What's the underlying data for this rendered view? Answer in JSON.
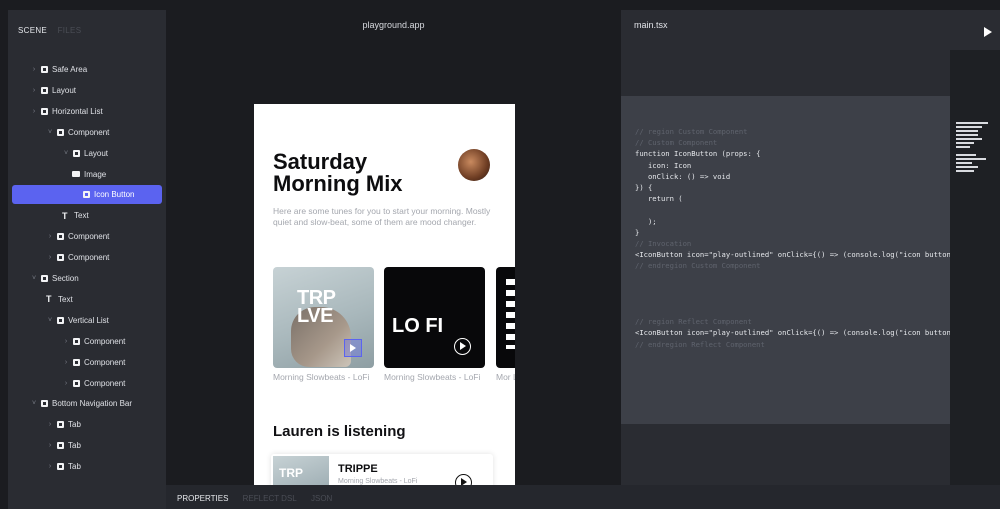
{
  "left_panel": {
    "tabs": [
      {
        "label": "SCENE",
        "active": true
      },
      {
        "label": "FILES",
        "active": false
      }
    ],
    "tree": [
      {
        "label": "Safe Area",
        "depth": 1,
        "icon": "component",
        "chevron": "right"
      },
      {
        "label": "Layout",
        "depth": 1,
        "icon": "component",
        "chevron": "right"
      },
      {
        "label": "Horizontal List",
        "depth": 1,
        "icon": "component",
        "chevron": "right"
      },
      {
        "label": "Component",
        "depth": 2,
        "icon": "component",
        "chevron": "down"
      },
      {
        "label": "Layout",
        "depth": 3,
        "icon": "component",
        "chevron": "down"
      },
      {
        "label": "Image",
        "depth": 4,
        "icon": "image"
      },
      {
        "label": "Icon Button",
        "depth": 4,
        "icon": "component",
        "selected": true
      },
      {
        "label": "Text",
        "depth": 3,
        "icon": "text"
      },
      {
        "label": "Component",
        "depth": 2,
        "icon": "component",
        "chevron": "right"
      },
      {
        "label": "Component",
        "depth": 2,
        "icon": "component",
        "chevron": "right"
      },
      {
        "label": "Section",
        "depth": 1,
        "icon": "component",
        "chevron": "down"
      },
      {
        "label": "Text",
        "depth": 2,
        "icon": "text"
      },
      {
        "label": "Vertical List",
        "depth": 2,
        "icon": "component",
        "chevron": "down"
      },
      {
        "label": "Component",
        "depth": 3,
        "icon": "component",
        "chevron": "right"
      },
      {
        "label": "Component",
        "depth": 3,
        "icon": "component",
        "chevron": "right"
      },
      {
        "label": "Component",
        "depth": 3,
        "icon": "component",
        "chevron": "right"
      },
      {
        "label": "Bottom Navigation Bar",
        "depth": 1,
        "icon": "component",
        "chevron": "down"
      },
      {
        "label": "Tab",
        "depth": 2,
        "icon": "component",
        "chevron": "right"
      },
      {
        "label": "Tab",
        "depth": 2,
        "icon": "component",
        "chevron": "right"
      },
      {
        "label": "Tab",
        "depth": 2,
        "icon": "component",
        "chevron": "right"
      }
    ]
  },
  "center": {
    "title": "playground.app",
    "phone": {
      "title": "Saturday Morning Mix",
      "description": "Here are some tunes for you to start your morning. Mostly quiet and slow-beat, some of them are mood changer.",
      "cards": [
        {
          "art_text": "TRP LVE",
          "caption": "Morning Slowbeats - LoFi"
        },
        {
          "art_text": "LO FI",
          "caption": "Morning Slowbeats - LoFi"
        },
        {
          "art_text": "",
          "caption": "Mor LoFi"
        }
      ],
      "section_title": "Lauren is listening",
      "listening": {
        "thumb_text": "TRP",
        "title": "TRIPPE",
        "subtitle": "Morning Slowbeats - LoFi"
      }
    }
  },
  "bottom_bar": {
    "tabs": [
      {
        "label": "PROPERTIES",
        "active": true
      },
      {
        "label": "REFLECT DSL",
        "active": false
      },
      {
        "label": "JSON",
        "active": false
      }
    ]
  },
  "code_panel": {
    "file": "main.tsx",
    "lines": [
      {
        "text": "// region Custom Component",
        "comment": true
      },
      {
        "text": "// Custom Component",
        "comment": true
      },
      {
        "text": "function IconButton (props: {",
        "comment": false
      },
      {
        "text": "   icon: Icon",
        "comment": false
      },
      {
        "text": "   onClick: () => void",
        "comment": false
      },
      {
        "text": "}) {",
        "comment": false
      },
      {
        "text": "   return (",
        "comment": false
      },
      {
        "text": "",
        "comment": false
      },
      {
        "text": "   );",
        "comment": false
      },
      {
        "text": "}",
        "comment": false
      },
      {
        "text": "// Invocation",
        "comment": true
      },
      {
        "text": "<IconButton icon=\"play-outlined\" onClick={() => (console.log(\"icon button",
        "comment": false
      },
      {
        "text": "// endregion Custom Component",
        "comment": true
      },
      {
        "text": "",
        "comment": false
      },
      {
        "text": "",
        "comment": false
      },
      {
        "text": "",
        "comment": false
      },
      {
        "text": "",
        "comment": false
      },
      {
        "text": "// region Reflect Component",
        "comment": true
      },
      {
        "text": "<IconButton icon=\"play-outlined\" onClick={() => (console.log(\"icon button",
        "comment": false
      },
      {
        "text": "// endregion Reflect Component",
        "comment": true
      }
    ]
  },
  "colors": {
    "accent": "#5b63f0",
    "panel": "#2a2c32",
    "code_bg": "#3d4048"
  }
}
